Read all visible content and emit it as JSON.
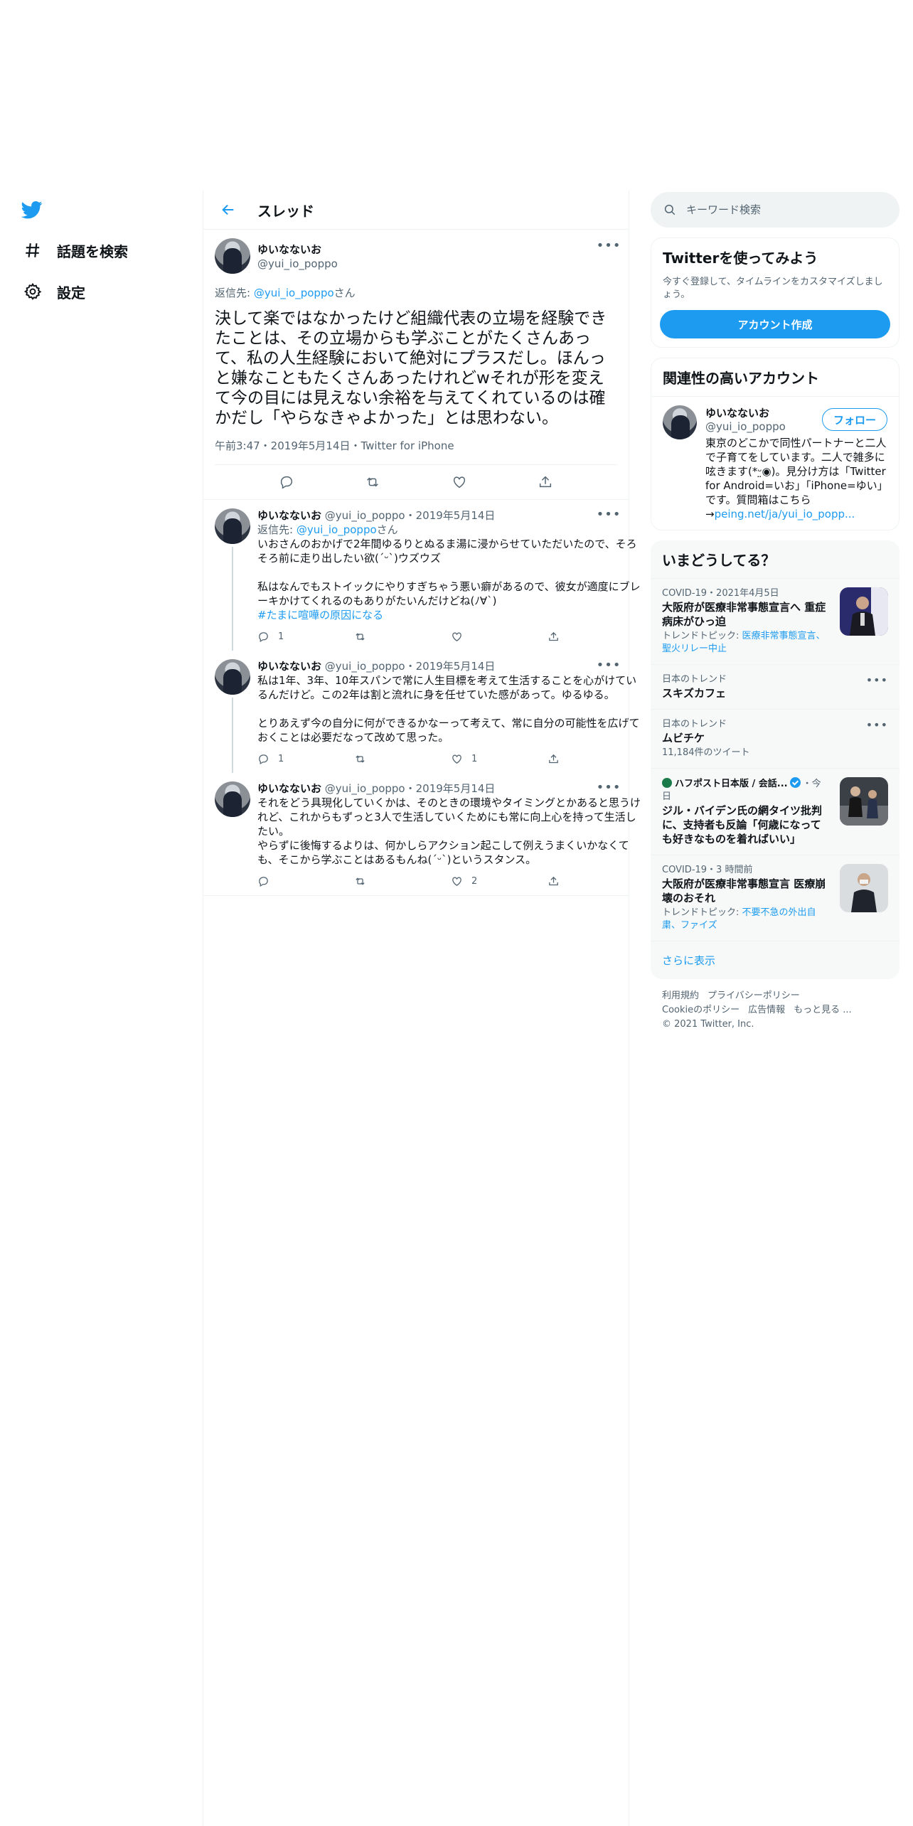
{
  "nav": {
    "items": [
      {
        "label": "話題を検索"
      },
      {
        "label": "設定"
      }
    ]
  },
  "thread": {
    "title": "スレッド",
    "main": {
      "name": "ゆいなないお",
      "handle": "@yui_io_poppo",
      "reply_prefix": "返信先: ",
      "reply_mention": "@yui_io_poppo",
      "reply_suffix": "さん",
      "text": "決して楽ではなかったけど組織代表の立場を経験できたことは、その立場からも学ぶことがたくさんあって、私の人生経験において絶対にプラスだし。ほんっと嫌なこともたくさんあったけれどwそれが形を変えて今の目には見えない余裕を与えてくれているのは確かだし「やらなきゃよかった」とは思わない。",
      "meta": "午前3:47・2019年5月14日・Twitter for iPhone"
    },
    "replies": [
      {
        "name": "ゆいなないお",
        "handle": "@yui_io_poppo",
        "date": "・2019年5月14日",
        "reply_prefix": "返信先: ",
        "reply_mention": "@yui_io_poppo",
        "reply_suffix": "さん",
        "text": "いおさんのおかげで2年間ゆるりとぬるま湯に浸からせていただいたので、そろそろ前に走り出したい欲(´ᵕ`)ウズウズ\n\n私はなんでもストイックにやりすぎちゃう悪い癖があるので、彼女が適度にブレーキかけてくれるのもありがたいんだけどね(ﾉ∀`)",
        "hashtag": "#たまに喧嘩の原因になる",
        "reply_count": "1",
        "retweet_count": "",
        "like_count": ""
      },
      {
        "name": "ゆいなないお",
        "handle": "@yui_io_poppo",
        "date": "・2019年5月14日",
        "text": "私は1年、3年、10年スパンで常に人生目標を考えて生活することを心がけているんだけど。この2年は割と流れに身を任せていた感があって。ゆるゆる。\n\nとりあえず今の自分に何ができるかなーって考えて、常に自分の可能性を広げておくことは必要だなって改めて思った。",
        "reply_count": "1",
        "retweet_count": "",
        "like_count": "1"
      },
      {
        "name": "ゆいなないお",
        "handle": "@yui_io_poppo",
        "date": "・2019年5月14日",
        "text": "それをどう具現化していくかは、そのときの環境やタイミングとかあると思うけれど、これからもずっと3人で生活していくためにも常に向上心を持って生活したい。\nやらずに後悔するよりは、何かしらアクション起こして例えうまくいかなくても、そこから学ぶことはあるもんね(´ᵕ`)というスタンス。",
        "reply_count": "",
        "retweet_count": "",
        "like_count": "2"
      }
    ]
  },
  "search": {
    "placeholder": "キーワード検索"
  },
  "signup": {
    "title": "Twitterを使ってみよう",
    "desc": "今すぐ登録して、タイムラインをカスタマイズしましょう。",
    "button": "アカウント作成"
  },
  "related": {
    "title": "関連性の高いアカウント",
    "name": "ゆいなないお",
    "handle": "@yui_io_poppo",
    "follow": "フォロー",
    "bio": "東京のどこかで同性パートナーと二人で子育てをしています。二人で雑多に呟きます(*ᵕ̤◉)。見分け方は「Twitter for Android=いお」「iPhone=ゆい」です。質問箱はこちら→",
    "bio_link": "peing.net/ja/yui_io_popp..."
  },
  "trends": {
    "title": "いまどうしてる？",
    "items": [
      {
        "category": "COVID-19・2021年4月5日",
        "title": "大阪府が医療非常事態宣言へ 重症病床がひっ迫",
        "sub_prefix": "トレンドトピック: ",
        "sub_link": "医療非常事態宣言、聖火リレー中止"
      },
      {
        "category": "日本のトレンド",
        "title": "スキズカフェ"
      },
      {
        "category": "日本のトレンド",
        "title": "ムビチケ",
        "sub": "11,184件のツイート"
      },
      {
        "source": "ハフポスト日本版 / 会話...",
        "time": "・今日",
        "title": "ジル・バイデン氏の網タイツ批判に、支持者も反論「何歳になっても好きなものを着ればいい」"
      },
      {
        "category": "COVID-19・3 時間前",
        "title": "大阪府が医療非常事態宣言 医療崩壊のおそれ",
        "sub_prefix": "トレンドトピック: ",
        "sub_link": "不要不急の外出自粛、ファイズ"
      }
    ],
    "show_more": "さらに表示"
  },
  "footer": {
    "links": [
      "利用規約",
      "プライバシーポリシー",
      "Cookieのポリシー",
      "広告情報",
      "もっと見る ..."
    ],
    "copyright": "© 2021 Twitter, Inc."
  },
  "colors": {
    "accent": "#1d9bf0",
    "text": "#0f1419",
    "muted": "#536471",
    "border": "#eff3f4"
  }
}
